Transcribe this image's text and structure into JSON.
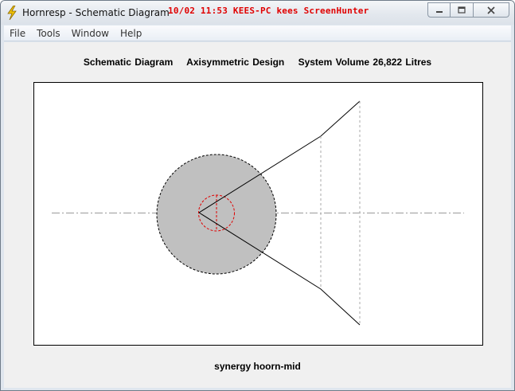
{
  "window": {
    "title": "Hornresp - Schematic Diagram",
    "overlay": "10/02  11:53  KEES-PC  kees  ScreenHunter",
    "overlay_color": "#e00000"
  },
  "menu": {
    "items": [
      {
        "label": "File"
      },
      {
        "label": "Tools"
      },
      {
        "label": "Window"
      },
      {
        "label": "Help"
      }
    ]
  },
  "heading": {
    "diagram_label": "Schematic Diagram",
    "design_label": "Axisymmetric Design",
    "volume_label": "System Volume 26,822 Litres"
  },
  "caption": "synergy hoorn-mid",
  "diagram": {
    "chamber_fill": "#c0c0c0",
    "driver_color": "#e00000",
    "axis_color": "#9a9a9a",
    "icons": [
      "lightning-icon",
      "minimize-icon",
      "maximize-icon",
      "close-icon"
    ]
  }
}
